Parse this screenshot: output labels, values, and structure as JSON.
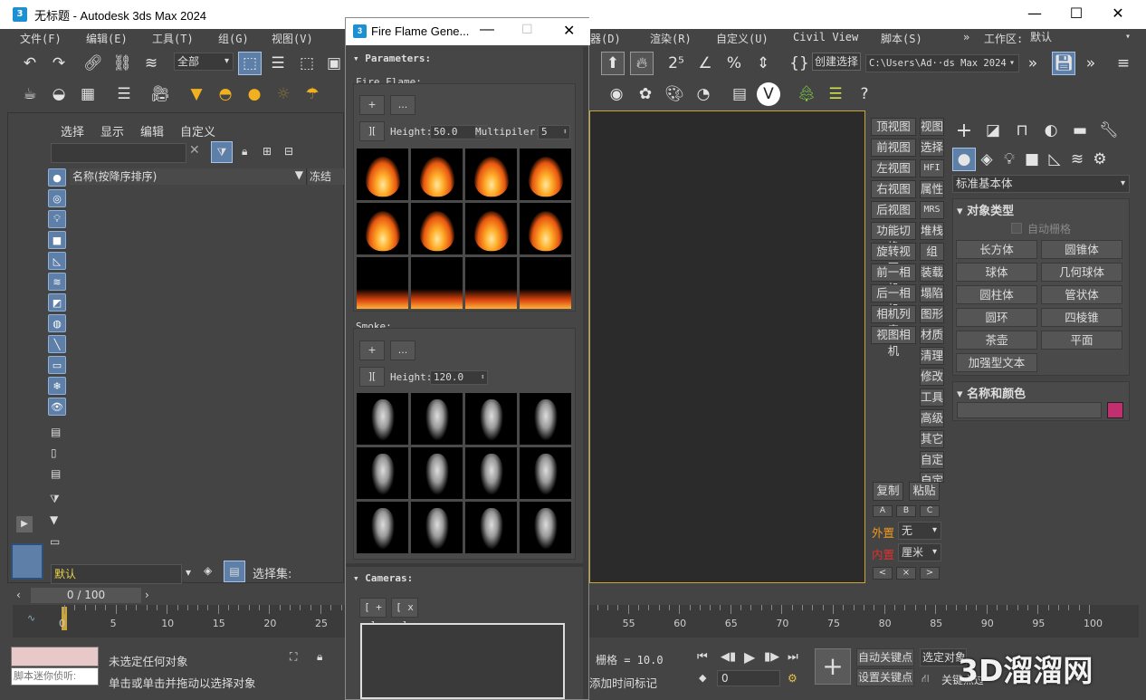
{
  "window": {
    "title": "无标题 - Autodesk 3ds Max 2024",
    "app_icon": "3"
  },
  "menu": {
    "items": [
      "文件(F)",
      "编辑(E)",
      "工具(T)",
      "组(G)",
      "视图(V)",
      "器(D)",
      "渲染(R)",
      "自定义(U)",
      "Civil View",
      "脚本(S)"
    ],
    "workspace_label": "工作区:",
    "workspace_value": "默认"
  },
  "toolbar": {
    "filter_value": "全部",
    "create_selection_label": "创建选择",
    "path_value": "C:\\Users\\Ad··ds Max 2024"
  },
  "scene_explorer": {
    "tabs": [
      "选择",
      "显示",
      "编辑",
      "自定义"
    ],
    "search_placeholder": "",
    "col_name": "名称(按降序排序)",
    "col_frozen": "冻结",
    "layer_value": "默认",
    "selection_set_label": "选择集:"
  },
  "fire_dialog": {
    "title": "Fire Flame Gene...",
    "parameters_header": "Parameters:",
    "fire_label": "Fire Flame:",
    "add_btn": "+",
    "more_btn": "...",
    "bracket_btn": "][",
    "height_label": "Height:",
    "fire_height": "50.0",
    "multiplier_label": "Multipiler:",
    "multiplier_value": "5",
    "smoke_label": "Smoke:",
    "smoke_height": "120.0",
    "cameras_header": "Cameras:",
    "cam_add": "[ + ]",
    "cam_remove": "[ x ]"
  },
  "viewport_buttons": {
    "col1": [
      "顶视图",
      "前视图",
      "左视图",
      "右视图",
      "后视图",
      "功能切换",
      "旋转视图",
      "前一相机",
      "后一相机",
      "相机列表",
      "视图相机"
    ],
    "col2": [
      "视图",
      "选择",
      "HFI",
      "属性",
      "MRS",
      "堆栈",
      "组",
      "装载",
      "塌陷",
      "图形",
      "材质",
      "清理",
      "修改",
      "工具",
      "高级",
      "其它",
      "自定",
      "自定"
    ],
    "copy": "复制",
    "paste": "粘贴",
    "abc": [
      "A",
      "B",
      "C"
    ],
    "outer_label": "外置",
    "outer_value": "无",
    "inner_label": "内置",
    "inner_value": "厘米",
    "nav": [
      "<",
      "×",
      ">"
    ]
  },
  "command_panel": {
    "category_value": "标准基本体",
    "object_type_header": "对象类型",
    "auto_grid": "自动栅格",
    "buttons": [
      "长方体",
      "圆锥体",
      "球体",
      "几何球体",
      "圆柱体",
      "管状体",
      "圆环",
      "四棱锥",
      "茶壶",
      "平面",
      "加强型文本"
    ],
    "name_color_header": "名称和颜色",
    "object_color": "#c0306e"
  },
  "timeline": {
    "frame_display": "0 / 100",
    "ticks": [
      0,
      5,
      10,
      15,
      20,
      25,
      55,
      60,
      65,
      70,
      75,
      80,
      85,
      90,
      95,
      100
    ]
  },
  "status": {
    "listener_placeholder": "脚本迷你侦听:",
    "line1": "未选定任何对象",
    "line2": "单击或单击并拖动以选择对象",
    "grid": "栅格 = 10.0",
    "add_time_tag": "添加时间标记",
    "auto_key": "自动关键点",
    "set_key": "设置关键点",
    "selected_object": "选定对象",
    "key_filter": "关键点过滤器",
    "frame_value": "0"
  },
  "watermark": "3D溜溜网"
}
